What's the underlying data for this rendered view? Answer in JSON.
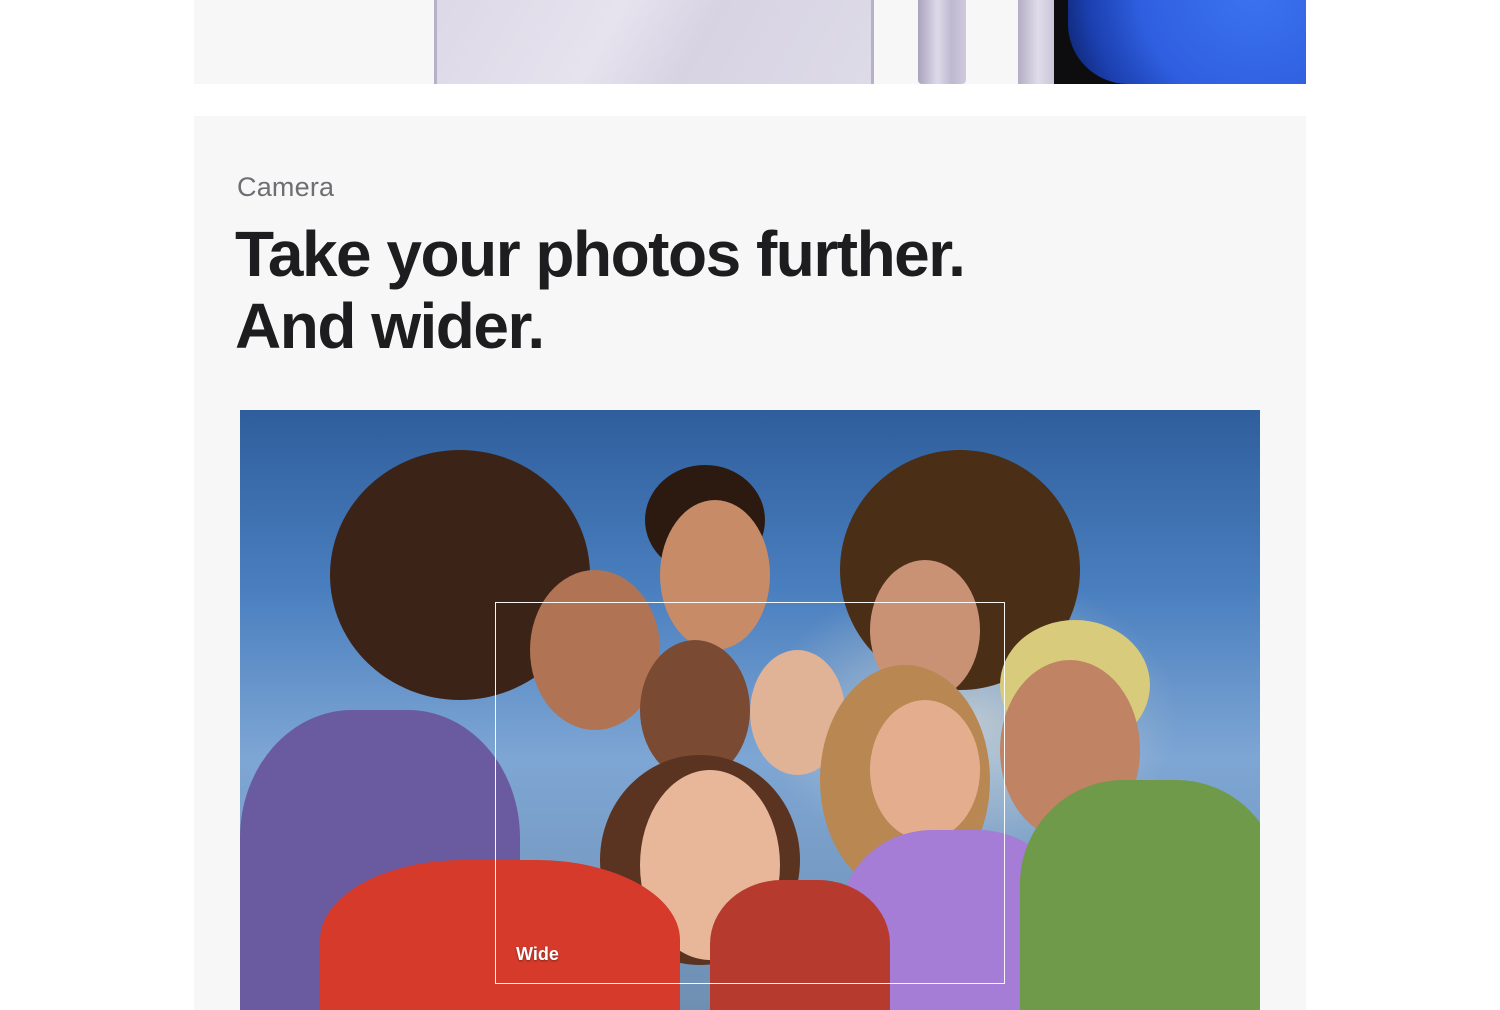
{
  "section": {
    "eyebrow": "Camera",
    "headline_line1": "Take your photos further.",
    "headline_line2": "And wider."
  },
  "photo": {
    "frame_label": "Wide"
  },
  "colors": {
    "section_bg": "#f7f7f7",
    "headline": "#1d1d1f",
    "eyebrow": "#6e6e73",
    "phone_purple": "#dcd8e6",
    "screen_blue": "#2f5fe0"
  }
}
